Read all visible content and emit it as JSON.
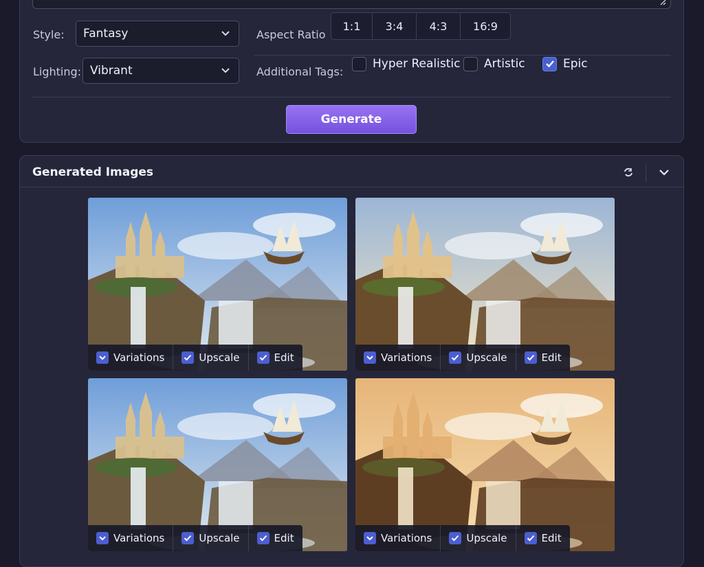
{
  "settings": {
    "style_label": "Style:",
    "style_value": "Fantasy",
    "lighting_label": "Lighting:",
    "lighting_value": "Vibrant",
    "aspect_label": "Aspect Ratio",
    "aspect_options": [
      "1:1",
      "3:4",
      "4:3",
      "16:9"
    ],
    "tags_label": "Additional Tags:",
    "tags": [
      {
        "label": "Hyper Realistic",
        "checked": false
      },
      {
        "label": "Artistic",
        "checked": false
      },
      {
        "label": "Epic",
        "checked": true
      }
    ],
    "generate_label": "Generate"
  },
  "images": {
    "title": "Generated Images",
    "items": [
      {
        "variations": "Variations",
        "upscale": "Upscale",
        "edit": "Edit",
        "tone": "day"
      },
      {
        "variations": "Variations",
        "upscale": "Upscale",
        "edit": "Edit",
        "tone": "warm"
      },
      {
        "variations": "Variations",
        "upscale": "Upscale",
        "edit": "Edit",
        "tone": "day"
      },
      {
        "variations": "Variations",
        "upscale": "Upscale",
        "edit": "Edit",
        "tone": "sunset"
      }
    ]
  },
  "colors": {
    "accent": "#8461ea",
    "checkbox": "#4a5fcf",
    "panel": "#25263a",
    "background": "#1a1a2a"
  }
}
